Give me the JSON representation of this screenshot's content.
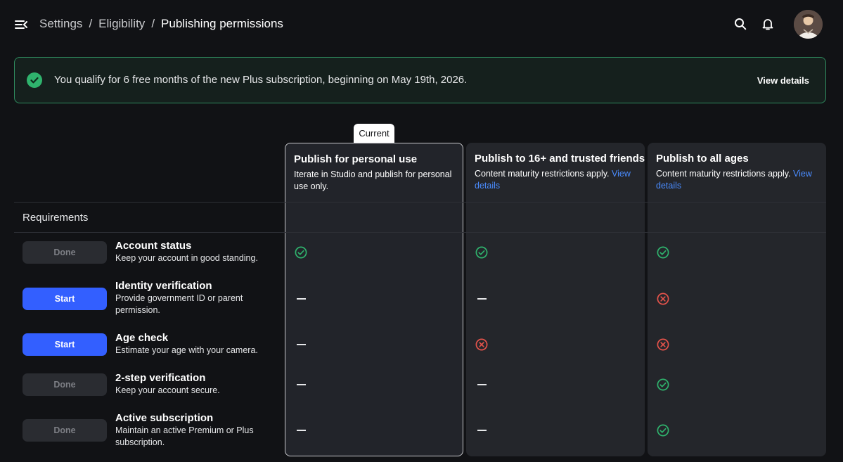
{
  "breadcrumb": {
    "items": [
      "Settings",
      "Eligibility",
      "Publishing permissions"
    ],
    "separator": "/"
  },
  "banner": {
    "text": "You qualify for 6 free months of the new Plus subscription, beginning on May 19th, 2026.",
    "button": "View details"
  },
  "plans": {
    "current_label": "Current",
    "columns": [
      {
        "title": "Publish for personal use",
        "desc": "Iterate in Studio and publish for personal use only.",
        "link": ""
      },
      {
        "title": "Publish to 16+ and trusted friends",
        "desc": "Content maturity restrictions apply.",
        "link": "View details"
      },
      {
        "title": "Publish to all ages",
        "desc": "Content maturity restrictions apply.",
        "link": "View details"
      }
    ]
  },
  "requirements": {
    "label": "Requirements",
    "rows": [
      {
        "button": "Done",
        "button_state": "done",
        "title": "Account status",
        "desc": "Keep your account in good standing.",
        "statuses": [
          "check",
          "check",
          "check"
        ]
      },
      {
        "button": "Start",
        "button_state": "start",
        "title": "Identity verification",
        "desc": "Provide government ID or parent permission.",
        "statuses": [
          "dash",
          "dash",
          "x"
        ]
      },
      {
        "button": "Start",
        "button_state": "start",
        "title": "Age check",
        "desc": "Estimate your age with your camera.",
        "statuses": [
          "dash",
          "x",
          "x"
        ]
      },
      {
        "button": "Done",
        "button_state": "done",
        "title": "2-step verification",
        "desc": "Keep your account secure.",
        "statuses": [
          "dash",
          "dash",
          "check"
        ]
      },
      {
        "button": "Done",
        "button_state": "done",
        "title": "Active subscription",
        "desc": "Maintain an active Premium or Plus subscription.",
        "statuses": [
          "dash",
          "dash",
          "check"
        ]
      }
    ]
  },
  "icons": {
    "menu": "menu-collapse-icon",
    "search": "search-icon",
    "bell": "bell-icon",
    "check": "check-circle-icon",
    "x": "x-circle-icon",
    "dash": "dash-icon"
  },
  "colors": {
    "accent": "#335fff",
    "success": "#2fb36d",
    "error": "#e5534b",
    "link": "#4a8cff",
    "banner_border": "#2f8a5e"
  }
}
